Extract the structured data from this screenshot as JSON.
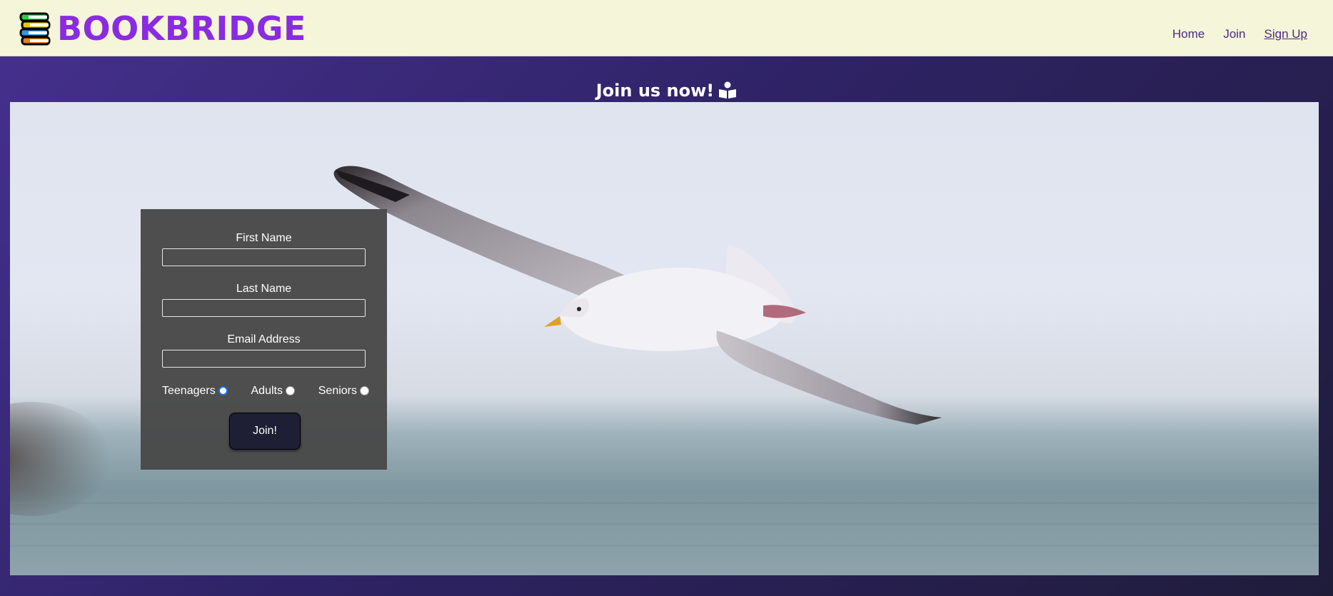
{
  "header": {
    "brand": "BOOKBRIDGE",
    "logo_icon": "books-stack-icon",
    "nav": [
      {
        "label": "Home"
      },
      {
        "label": "Join"
      },
      {
        "label": "Sign Up",
        "active": true
      }
    ]
  },
  "main": {
    "heading": "Join us now!",
    "heading_icon": "book-reader-icon"
  },
  "form": {
    "first_name_label": "First Name",
    "first_name_value": "",
    "last_name_label": "Last Name",
    "last_name_value": "",
    "email_label": "Email Address",
    "email_value": "",
    "audience_options": [
      {
        "label": "Teenagers",
        "checked": true
      },
      {
        "label": "Adults",
        "checked": false
      },
      {
        "label": "Seniors",
        "checked": false
      }
    ],
    "submit_label": "Join!"
  },
  "colors": {
    "brand": "#8a2be2",
    "header_bg": "#f5f5da",
    "nav_text": "#4b2a82",
    "page_bg": "#2f2366",
    "form_bg": "#484848",
    "button_bg": "#1e1e34"
  }
}
